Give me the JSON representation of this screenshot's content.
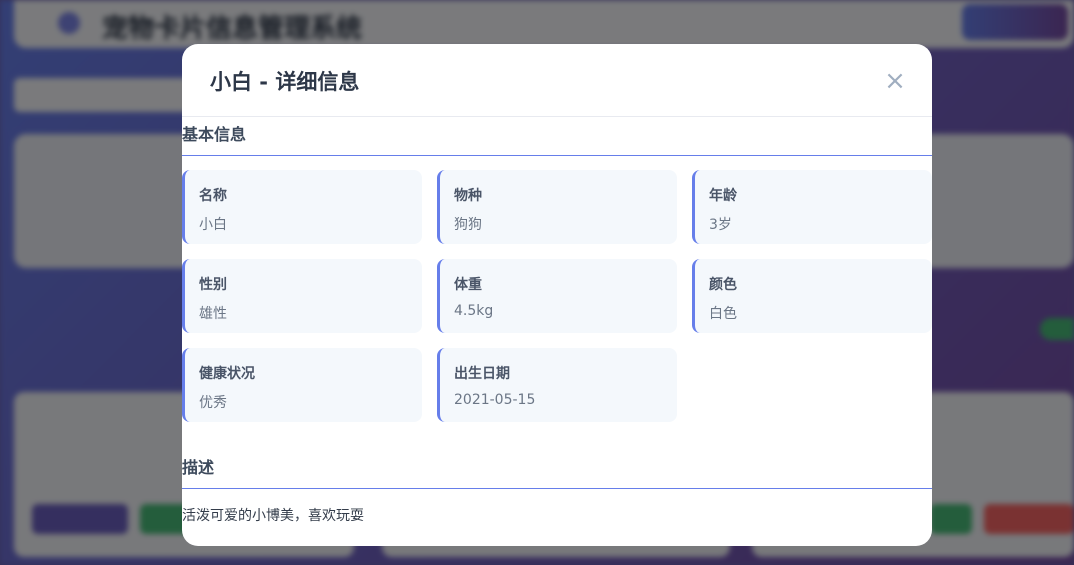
{
  "background": {
    "app_title": "宠物卡片信息管理系统"
  },
  "modal": {
    "title": "小白 - 详细信息",
    "close_symbol": "×",
    "basic_section_title": "基本信息",
    "fields": [
      {
        "label": "名称",
        "value": "小白"
      },
      {
        "label": "物种",
        "value": "狗狗"
      },
      {
        "label": "年龄",
        "value": "3岁"
      },
      {
        "label": "性别",
        "value": "雄性"
      },
      {
        "label": "体重",
        "value": "4.5kg"
      },
      {
        "label": "颜色",
        "value": "白色"
      },
      {
        "label": "健康状况",
        "value": "优秀"
      },
      {
        "label": "出生日期",
        "value": "2021-05-15"
      }
    ],
    "description_section_title": "描述",
    "description": "活泼可爱的小博美，喜欢玩耍"
  },
  "colors": {
    "accent": "#667eea",
    "modal_bg": "#ffffff",
    "card_bg": "#f4f8fc",
    "close_icon": "#a0aec0",
    "title_text": "#2d3748"
  }
}
